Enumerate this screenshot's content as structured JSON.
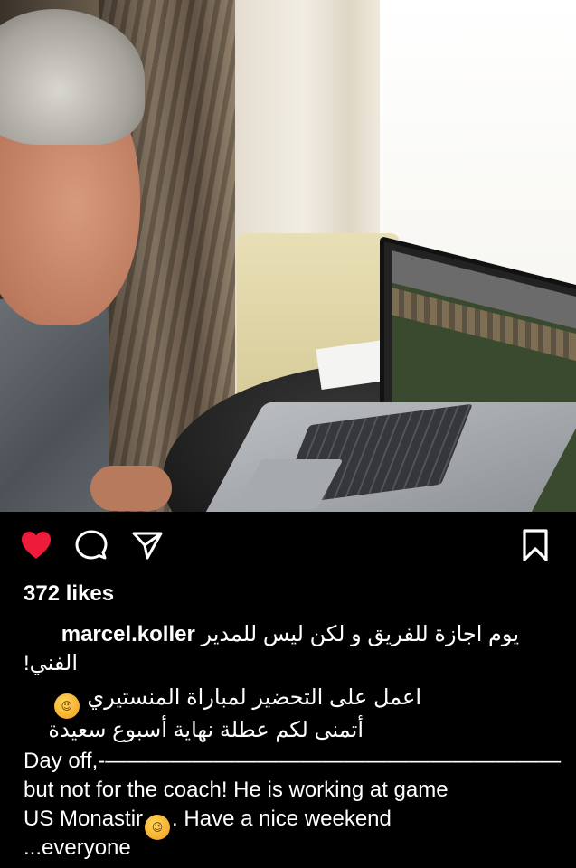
{
  "post": {
    "likes": "372 likes",
    "username": "marcel.koller",
    "caption_ar_line1": "يوم اجازة للفريق و لكن ليس للمدير",
    "caption_ar_line2": "الفني!",
    "caption_ar_line3": "اعمل على التحضير لمباراة المنستيري",
    "caption_ar_line4": "أتمنى لكم عطلة نهاية أسبوع سعيدة",
    "caption_en_line1": "Day off,-—————————————————————",
    "caption_en_line2": "but not for the coach! He is working at game",
    "caption_en_line3a": "US Monastir",
    "caption_en_line3b": ". Have a nice weekend",
    "caption_en_line4": "...everyone",
    "emoji_name": "winking-face",
    "emoji_glyph": "😉"
  },
  "icons": {
    "like": "heart-icon",
    "comment": "comment-icon",
    "share": "share-icon",
    "save": "bookmark-icon"
  },
  "colors": {
    "background": "#000000",
    "text": "#ffffff",
    "heart": "#ed1c3b"
  }
}
